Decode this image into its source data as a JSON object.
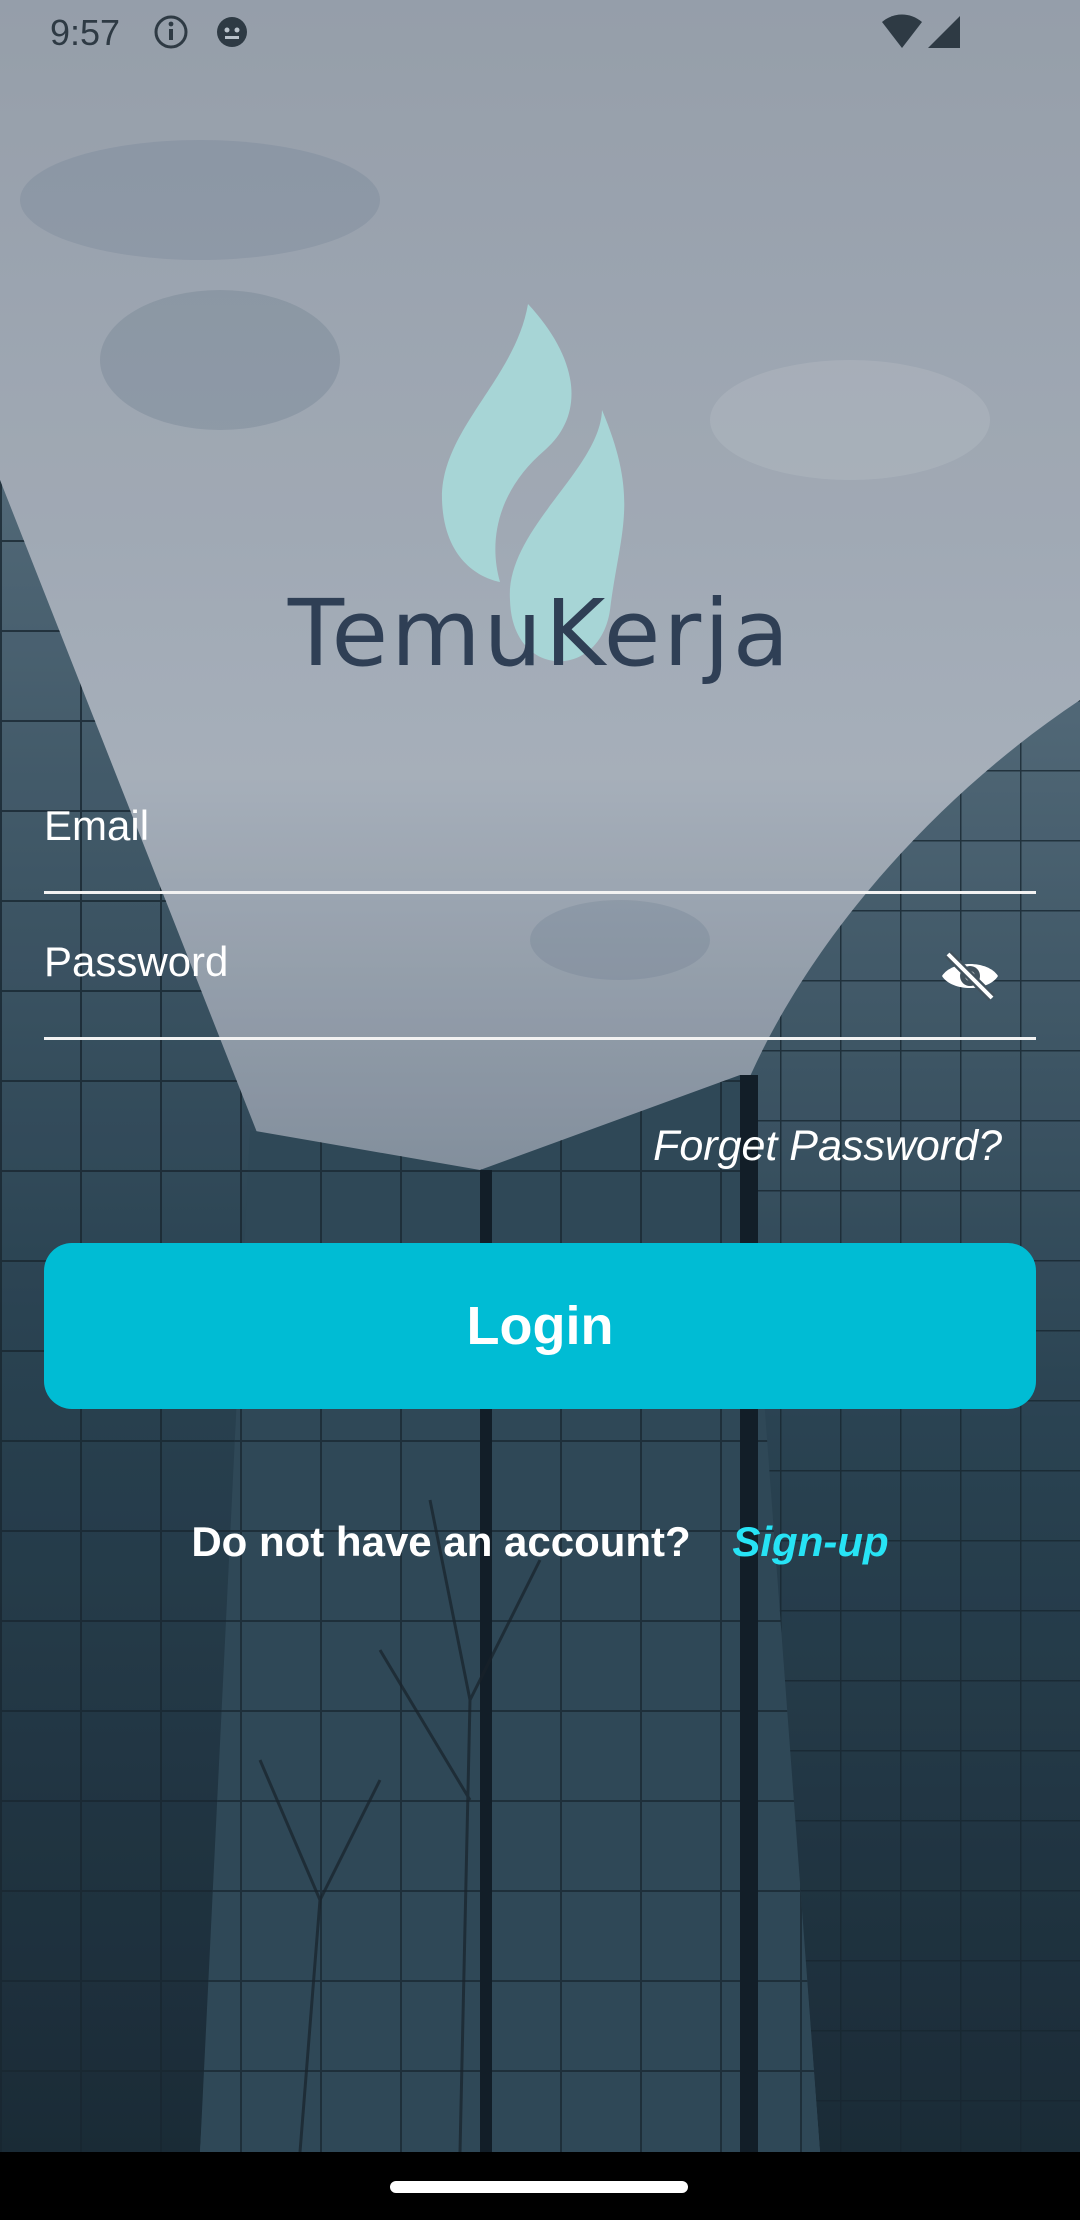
{
  "status": {
    "time": "9:57"
  },
  "brand": {
    "name": "TemuKerja"
  },
  "login_form": {
    "email_label": "Email",
    "password_label": "Password",
    "forgot_password": "Forget Password?",
    "login_button": "Login"
  },
  "signup": {
    "question": "Do not have an account?",
    "link": "Sign-up"
  },
  "colors": {
    "primary": "#00bcd4",
    "link_accent": "#27e3f5",
    "logo_teal": "#a7d5d6",
    "logo_text": "#2f3f55"
  }
}
